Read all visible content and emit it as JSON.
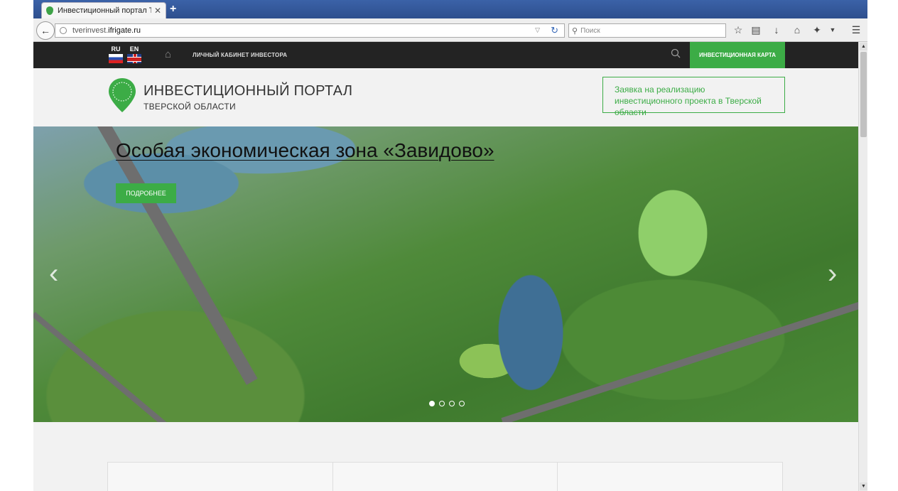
{
  "browser": {
    "tab_title": "Инвестиционный портал Тв...",
    "tab_close": "✕",
    "new_tab": "+",
    "url_prefix": "tverinvest.",
    "url_domain": "ifrigate.ru",
    "search_placeholder": "Поиск"
  },
  "topbar": {
    "lang_ru": "RU",
    "lang_en": "EN",
    "cabinet_label": "ЛИЧНЫЙ КАБИНЕТ ИНВЕСТОРА",
    "map_button": "ИНВЕСТИЦИОННАЯ КАРТА"
  },
  "header": {
    "title": "ИНВЕСТИЦИОННЫЙ ПОРТАЛ",
    "subtitle": "ТВЕРСКОЙ ОБЛАСТИ",
    "apply_button": "Заявка на реализацию инвестиционного проекта в Тверской области"
  },
  "hero": {
    "title": "Особая экономическая зона «Завидово»",
    "more_button": "ПОДРОБНЕЕ",
    "slides_total": 4,
    "active_slide": 1
  },
  "colors": {
    "accent": "#3cac46",
    "topbar": "#232323"
  }
}
